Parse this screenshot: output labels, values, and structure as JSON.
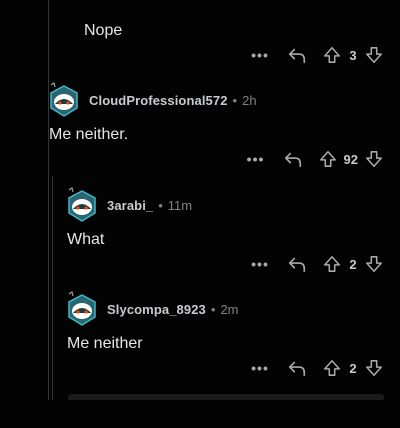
{
  "thread": {
    "partial_top": {
      "body": "Nope",
      "score": "3"
    },
    "comments": [
      {
        "author": "CloudProfessional572",
        "time": "2h",
        "body": "Me neither.",
        "score": "92"
      },
      {
        "author": "3arabi_",
        "time": "11m",
        "body": "What",
        "score": "2"
      },
      {
        "author": "Slycompa_8923",
        "time": "2m",
        "body": "Me neither",
        "score": "2"
      }
    ],
    "separator": "•",
    "more_label": "•••"
  },
  "icons": {
    "more": "more-dots-icon",
    "reply": "reply-arrow-icon",
    "upvote": "upvote-arrow-icon",
    "downvote": "downvote-arrow-icon",
    "avatar": "snoo-avatar-icon"
  },
  "colors": {
    "background": "#030303",
    "text": "#d7dadc",
    "meta": "#818384",
    "avatar_teal": "#3fb6c9"
  }
}
